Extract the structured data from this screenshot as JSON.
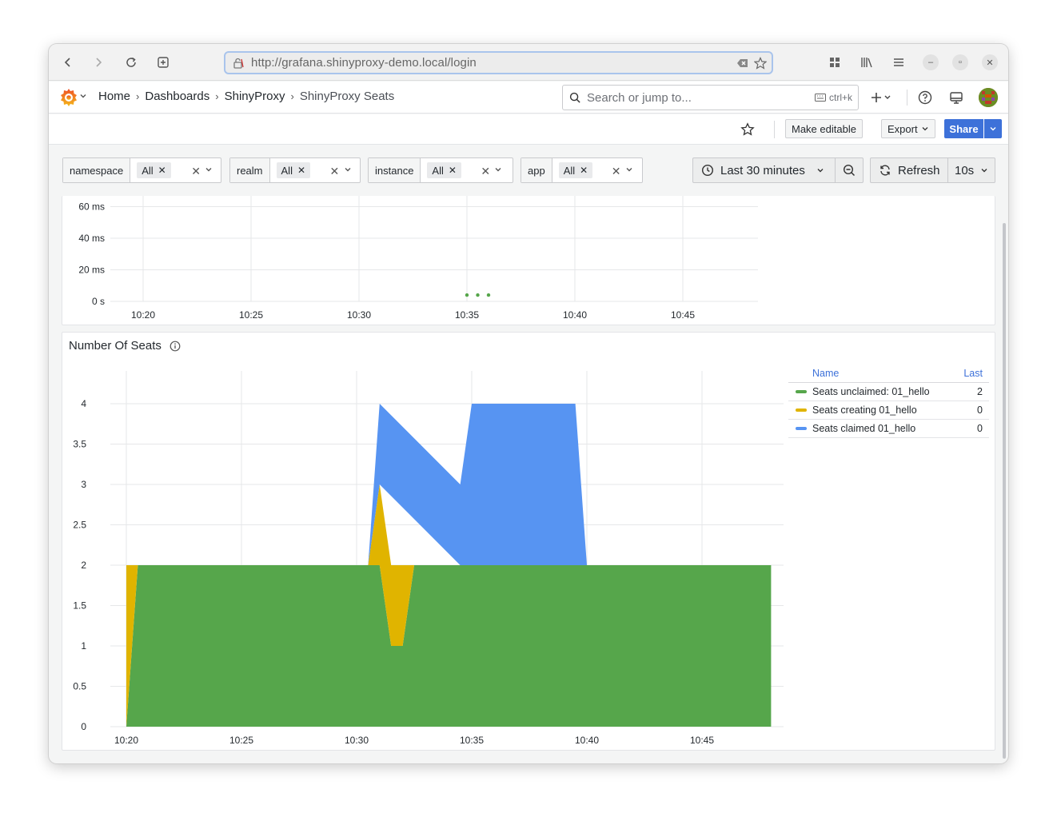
{
  "browser": {
    "url": "http://grafana.shinyproxy-demo.local/login"
  },
  "nav": {
    "breadcrumbs": [
      {
        "label": "Home"
      },
      {
        "label": "Dashboards"
      },
      {
        "label": "ShinyProxy"
      },
      {
        "label": "ShinyProxy Seats"
      }
    ],
    "search_placeholder": "Search or jump to...",
    "search_shortcut": "ctrl+k"
  },
  "actions": {
    "make_editable": "Make editable",
    "export": "Export",
    "share": "Share"
  },
  "variables": [
    {
      "label": "namespace",
      "value": "All"
    },
    {
      "label": "realm",
      "value": "All"
    },
    {
      "label": "instance",
      "value": "All"
    },
    {
      "label": "app",
      "value": "All"
    }
  ],
  "time_range": "Last 30 minutes",
  "refresh": {
    "label": "Refresh",
    "interval": "10s"
  },
  "colors": {
    "accent": "#3d71d9",
    "green": "#56a64b",
    "yellow": "#e0b400",
    "blue": "#5794f2"
  },
  "chart_data": [
    {
      "type": "scatter",
      "title": "",
      "y_ticks": [
        "0 s",
        "20 ms",
        "40 ms",
        "60 ms"
      ],
      "x_ticks": [
        "10:20",
        "10:25",
        "10:30",
        "10:35",
        "10:40",
        "10:45"
      ],
      "ylim_ms": [
        0,
        60
      ],
      "series": [
        {
          "x": [
            "10:35:00",
            "10:35:30",
            "10:36:00"
          ],
          "values_ms": [
            4,
            4,
            4
          ]
        }
      ],
      "grid": true
    },
    {
      "type": "area",
      "title": "Number Of Seats",
      "stacked": true,
      "y_ticks": [
        "0",
        "0.5",
        "1",
        "1.5",
        "2",
        "2.5",
        "3",
        "3.5",
        "4"
      ],
      "x_ticks": [
        "10:20",
        "10:25",
        "10:30",
        "10:35",
        "10:40",
        "10:45"
      ],
      "ylim": [
        0,
        4.5
      ],
      "x_min_range": [
        "10:17:30",
        "10:48:30"
      ],
      "grid": true,
      "legend_placement": "right",
      "legend_headers": {
        "name": "Name",
        "last": "Last"
      },
      "series": [
        {
          "name": "Seats unclaimed: 01_hello",
          "color": "#56a64b",
          "last": "2",
          "points": [
            [
              "10:20:00",
              0
            ],
            [
              "10:20:30",
              2
            ],
            [
              "10:30:30",
              2
            ],
            [
              "10:31:00",
              2
            ],
            [
              "10:31:30",
              1
            ],
            [
              "10:32:00",
              1
            ],
            [
              "10:32:30",
              2
            ],
            [
              "10:48:00",
              2
            ]
          ]
        },
        {
          "name": "Seats creating 01_hello",
          "color": "#e0b400",
          "last": "0",
          "points": [
            [
              "10:20:00",
              2
            ],
            [
              "10:20:30",
              0
            ],
            [
              "10:30:30",
              0
            ],
            [
              "10:31:00",
              1
            ],
            [
              "10:31:30",
              1
            ],
            [
              "10:32:00",
              1
            ],
            [
              "10:32:30",
              0
            ],
            [
              "10:48:00",
              0
            ]
          ]
        },
        {
          "name": "Seats claimed 01_hello",
          "color": "#5794f2",
          "last": "0",
          "points": [
            [
              "10:30:30",
              0
            ],
            [
              "10:31:00",
              1
            ],
            [
              "10:34:30",
              1
            ],
            [
              "10:35:00",
              2
            ],
            [
              "10:39:30",
              2
            ],
            [
              "10:40:00",
              0
            ]
          ]
        }
      ]
    }
  ]
}
